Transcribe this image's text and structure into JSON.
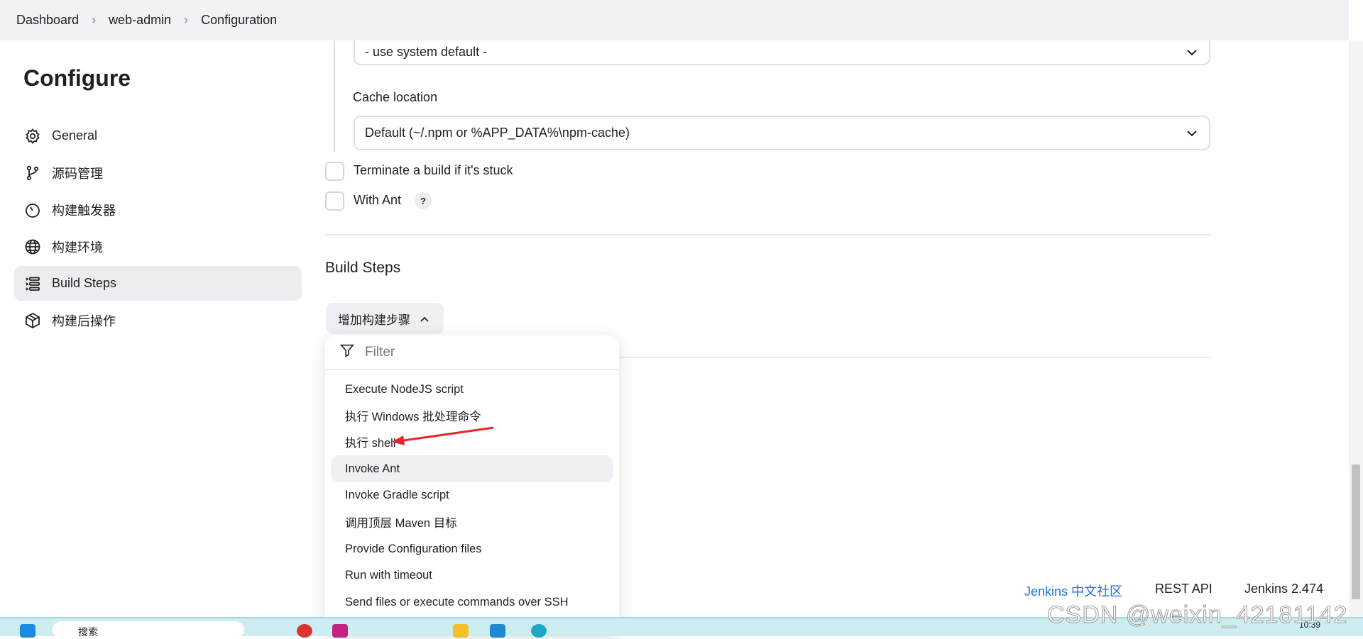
{
  "breadcrumb": [
    "Dashboard",
    "web-admin",
    "Configuration"
  ],
  "sidebar": {
    "title": "Configure",
    "items": [
      {
        "label": "General",
        "icon": "gear-icon"
      },
      {
        "label": "源码管理",
        "icon": "branch-icon"
      },
      {
        "label": "构建触发器",
        "icon": "timer-icon"
      },
      {
        "label": "构建环境",
        "icon": "globe-icon"
      },
      {
        "label": "Build Steps",
        "icon": "list-icon",
        "active": true
      },
      {
        "label": "构建后操作",
        "icon": "package-icon"
      }
    ]
  },
  "main": {
    "npmrc_select": "- use system default -",
    "cache_label": "Cache location",
    "cache_select": "Default (~/.npm or %APP_DATA%\\npm-cache)",
    "terminate_label": "Terminate a build if it's stuck",
    "with_ant_label": "With Ant",
    "help": "?",
    "build_steps_title": "Build Steps",
    "add_step_label": "增加构建步骤"
  },
  "menu": {
    "filter_placeholder": "Filter",
    "items": [
      "Execute NodeJS script",
      "执行 Windows 批处理命令",
      "执行 shell",
      "Invoke Ant",
      "Invoke Gradle script",
      "调用顶层 Maven 目标",
      "Provide Configuration files",
      "Run with timeout",
      "Send files or execute commands over SSH"
    ],
    "highlighted": "Invoke Ant"
  },
  "footer": {
    "community": "Jenkins 中文社区",
    "rest_api": "REST API",
    "version": "Jenkins 2.474"
  },
  "taskbar": {
    "search": "搜索",
    "time": "10:39"
  },
  "watermark": "CSDN @weixin_42181142",
  "colors": {
    "link": "#1a73e8",
    "annotation_arrow": "#e8262a",
    "taskbar": "#cdeef0"
  }
}
